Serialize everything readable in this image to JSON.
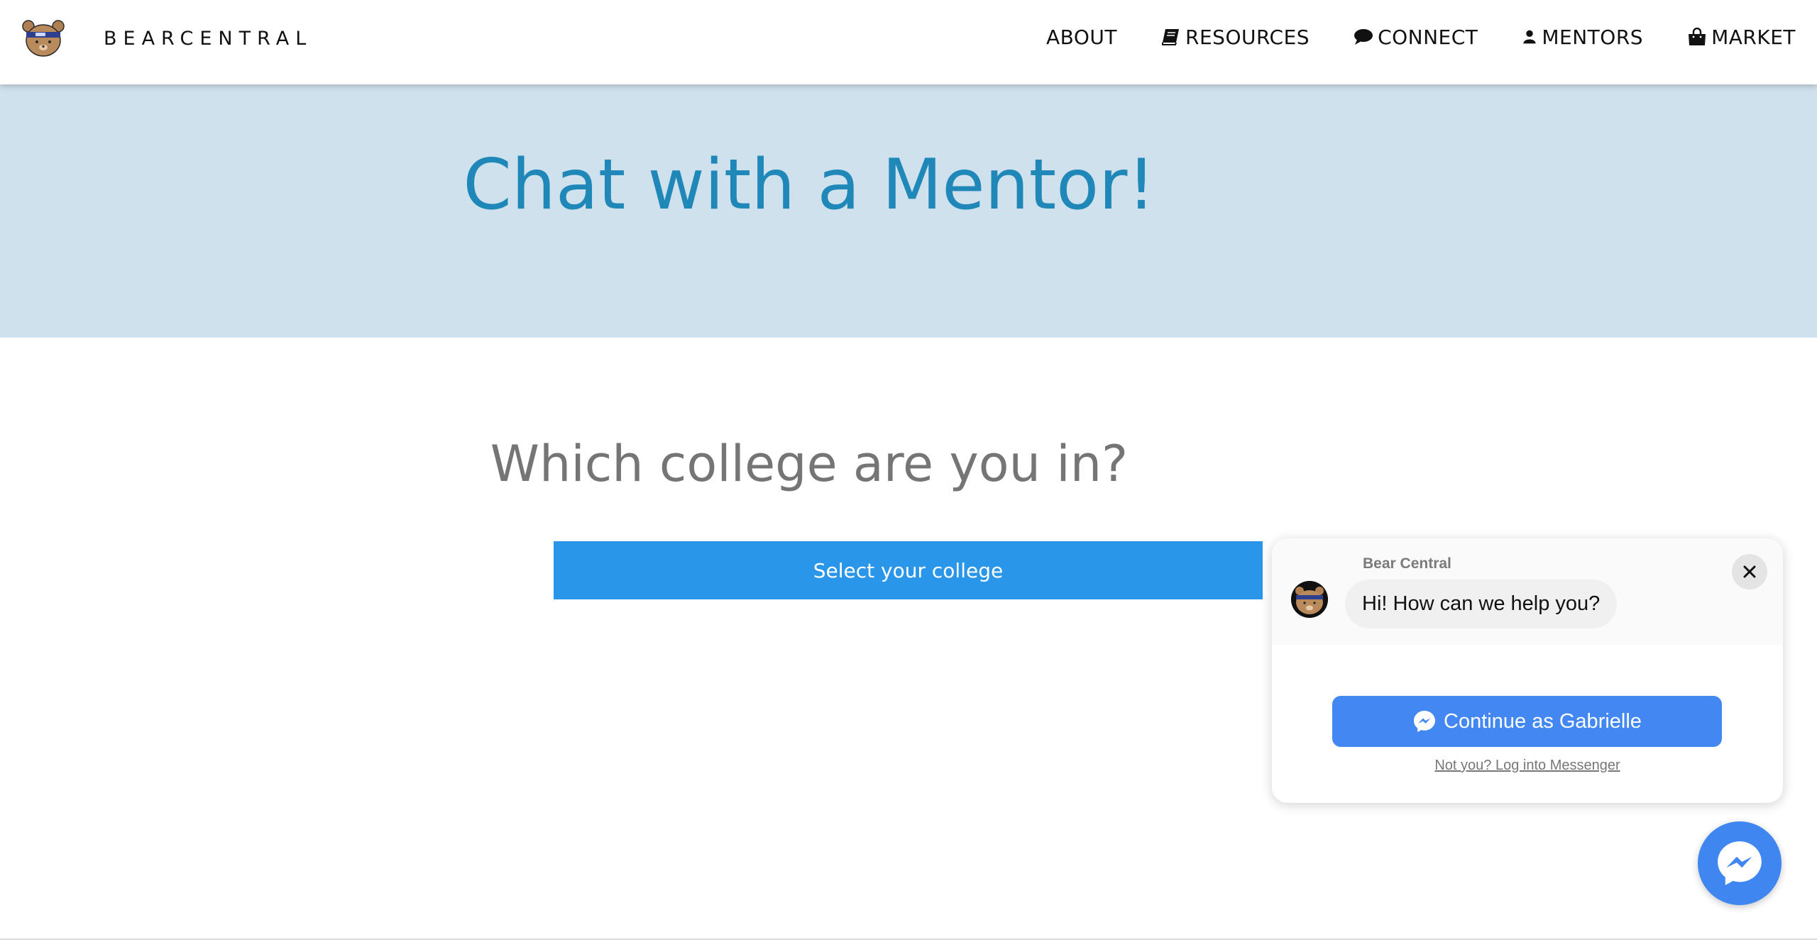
{
  "nav": {
    "brand": "BEARCENTRAL",
    "links": [
      {
        "label": "ABOUT",
        "icon": ""
      },
      {
        "label": "RESOURCES",
        "icon": "book-icon"
      },
      {
        "label": "CONNECT",
        "icon": "speech-bubble-icon"
      },
      {
        "label": "MENTORS",
        "icon": "user-icon"
      },
      {
        "label": "MARKET",
        "icon": "shopping-bag-icon"
      }
    ]
  },
  "hero": {
    "title": "Chat with a Mentor!"
  },
  "main": {
    "question": "Which college are you in?",
    "select_label": "Select your college"
  },
  "chat": {
    "sender": "Bear Central",
    "message": "Hi! How can we help you?",
    "continue_label": "Continue as Gabrielle",
    "not_you_label": "Not you? Log into Messenger"
  },
  "colors": {
    "hero_bg": "#cfe1ec",
    "hero_title": "#1f88b9",
    "select_button": "#2a96ea",
    "messenger_blue": "#4287f2"
  }
}
